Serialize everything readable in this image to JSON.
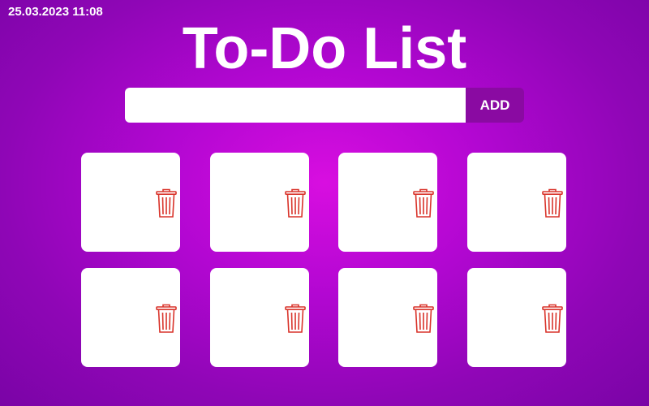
{
  "header": {
    "datetime": "25.03.2023 11:08",
    "title": "To-Do List"
  },
  "form": {
    "input_value": "",
    "input_placeholder": "",
    "add_label": "ADD"
  },
  "tasks": [
    {
      "text": ""
    },
    {
      "text": ""
    },
    {
      "text": ""
    },
    {
      "text": ""
    },
    {
      "text": ""
    },
    {
      "text": ""
    },
    {
      "text": ""
    },
    {
      "text": ""
    }
  ],
  "icons": {
    "delete": "trash-icon"
  },
  "colors": {
    "background_center": "#d80ee0",
    "background_edge": "#7a04a6",
    "add_button": "#8a0aa2",
    "card": "#ffffff",
    "trash_icon": "#d9342b",
    "text": "#ffffff"
  }
}
